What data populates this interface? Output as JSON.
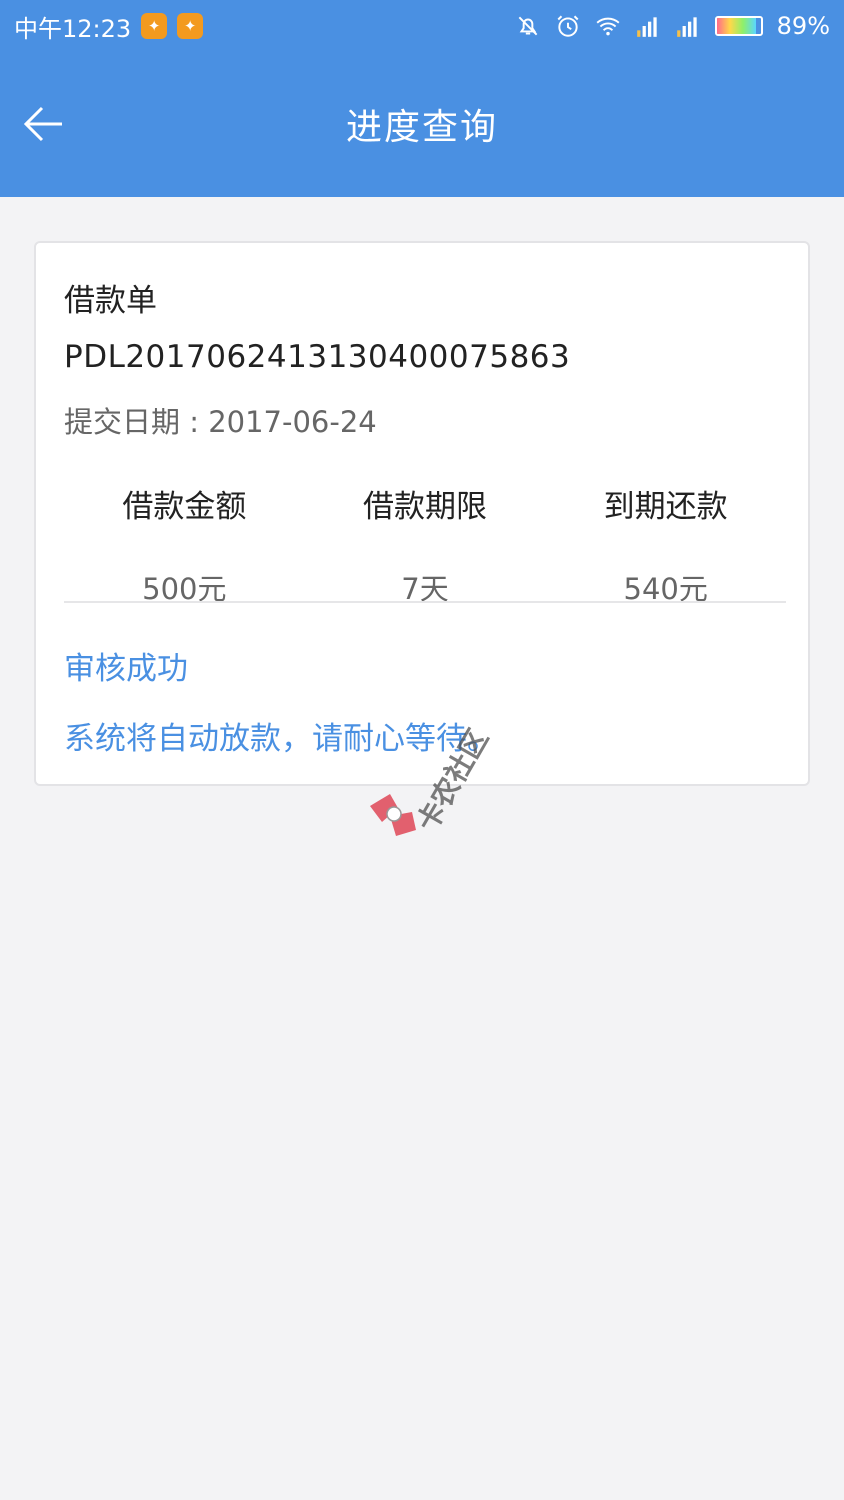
{
  "statusbar": {
    "time": "中午12:23",
    "battery": "89%",
    "battery_level": 0.89,
    "icons": [
      "uc-browser-icon",
      "uc-browser-icon",
      "mute-icon",
      "alarm-icon",
      "wifi-icon",
      "signal-icon",
      "signal-icon",
      "battery-icon"
    ]
  },
  "header": {
    "title": "进度查询",
    "back_icon": "back-arrow-icon"
  },
  "card": {
    "doc_type": "借款单",
    "doc_no": "PDL2017062413130400075863",
    "submit_date": "提交日期 : 2017-06-24",
    "stats": [
      {
        "label": "借款金额",
        "value": "500元"
      },
      {
        "label": "借款期限",
        "value": "7天"
      },
      {
        "label": "到期还款",
        "value": "540元"
      }
    ],
    "status": "审核成功",
    "status_desc": "系统将自动放款，请耐心等待。"
  },
  "watermark": {
    "text": "卡农社区"
  },
  "colors": {
    "accent": "#4a90e2",
    "background": "#f3f3f5"
  }
}
